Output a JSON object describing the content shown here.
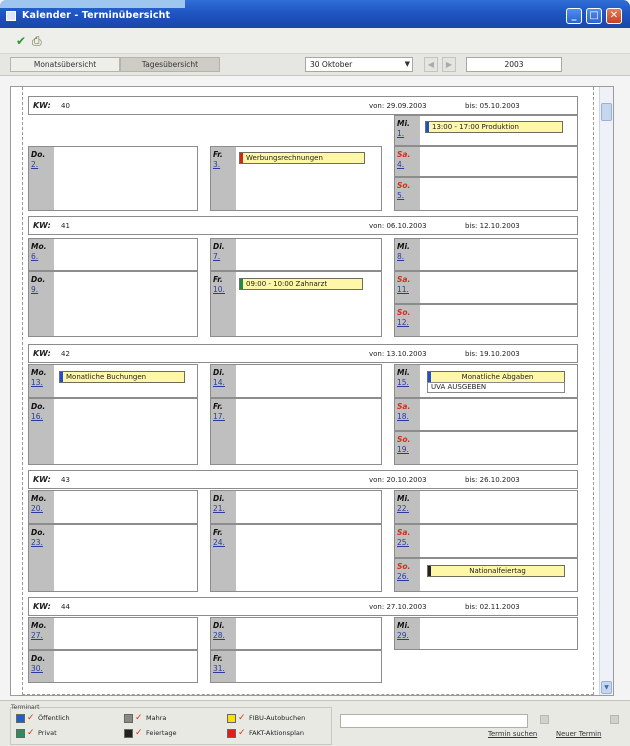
{
  "window": {
    "title": "Kalender - Terminübersicht",
    "buttons": {
      "minimize": "_",
      "maximize": "□",
      "close": "✕"
    }
  },
  "toolbar": {
    "check_icon": "✔",
    "print_icon": "⎙"
  },
  "tabs": {
    "month": "Monatsübersicht",
    "day": "Tagesübersicht",
    "date_select": "30 Oktober",
    "prev": "◀",
    "next": "▶",
    "year": "2003"
  },
  "weeks": [
    {
      "kw_label": "KW:",
      "number": "40",
      "von_label": "von:",
      "von": "29.09.2003",
      "bis_label": "bis:",
      "bis": "05.10.2003"
    },
    {
      "kw_label": "KW:",
      "number": "41",
      "von_label": "von:",
      "von": "06.10.2003",
      "bis_label": "bis:",
      "bis": "12.10.2003"
    },
    {
      "kw_label": "KW:",
      "number": "42",
      "von_label": "von:",
      "von": "13.10.2003",
      "bis_label": "bis:",
      "bis": "19.10.2003"
    },
    {
      "kw_label": "KW:",
      "number": "43",
      "von_label": "von:",
      "von": "20.10.2003",
      "bis_label": "bis:",
      "bis": "26.10.2003"
    },
    {
      "kw_label": "KW:",
      "number": "44",
      "von_label": "von:",
      "von": "27.10.2003",
      "bis_label": "bis:",
      "bis": "02.11.2003"
    }
  ],
  "days": {
    "w40_mi": {
      "name": "Mi.",
      "date": "1."
    },
    "w40_do": {
      "name": "Do.",
      "date": "2."
    },
    "w40_fr": {
      "name": "Fr.",
      "date": "3."
    },
    "w40_sa": {
      "name": "Sa.",
      "date": "4."
    },
    "w40_so": {
      "name": "So.",
      "date": "5."
    },
    "w41_mo": {
      "name": "Mo.",
      "date": "6."
    },
    "w41_di": {
      "name": "Di.",
      "date": "7."
    },
    "w41_mi": {
      "name": "Mi.",
      "date": "8."
    },
    "w41_do": {
      "name": "Do.",
      "date": "9."
    },
    "w41_fr": {
      "name": "Fr.",
      "date": "10."
    },
    "w41_sa": {
      "name": "Sa.",
      "date": "11."
    },
    "w41_so": {
      "name": "So.",
      "date": "12."
    },
    "w42_mo": {
      "name": "Mo.",
      "date": "13."
    },
    "w42_di": {
      "name": "Di.",
      "date": "14."
    },
    "w42_mi": {
      "name": "Mi.",
      "date": "15."
    },
    "w42_do": {
      "name": "Do.",
      "date": "16."
    },
    "w42_fr": {
      "name": "Fr.",
      "date": "17."
    },
    "w42_sa": {
      "name": "Sa.",
      "date": "18."
    },
    "w42_so": {
      "name": "So.",
      "date": "19."
    },
    "w43_mo": {
      "name": "Mo.",
      "date": "20."
    },
    "w43_di": {
      "name": "Di.",
      "date": "21."
    },
    "w43_mi": {
      "name": "Mi.",
      "date": "22."
    },
    "w43_do": {
      "name": "Do.",
      "date": "23."
    },
    "w43_fr": {
      "name": "Fr.",
      "date": "24."
    },
    "w43_sa": {
      "name": "Sa.",
      "date": "25."
    },
    "w43_so": {
      "name": "So.",
      "date": "26."
    },
    "w44_mo": {
      "name": "Mo.",
      "date": "27."
    },
    "w44_di": {
      "name": "Di.",
      "date": "28."
    },
    "w44_mi": {
      "name": "Mi.",
      "date": "29."
    },
    "w44_do": {
      "name": "Do.",
      "date": "30."
    },
    "w44_fr": {
      "name": "Fr.",
      "date": "31."
    }
  },
  "events": {
    "produktion": {
      "text": "13:00 - 17:00 Produktion",
      "color": "#1f4fd0"
    },
    "werbung": {
      "text": "Werbungsrechnungen",
      "color": "#d02818"
    },
    "zahnarzt": {
      "text": "09:00 - 10:00   Zahnarzt",
      "color": "#1f8a4c"
    },
    "buchungen": {
      "text": "Monatliche Buchungen",
      "color": "#1f4fd0"
    },
    "abgaben": {
      "text": "Monatliche Abgaben",
      "sub": "UVA AUSGEBEN",
      "color": "#1f4fd0"
    },
    "nationalfeiertag": {
      "text": "Nationalfeiertag",
      "color": "#222222"
    }
  },
  "footer": {
    "group_label": "Terminart",
    "legend": [
      {
        "label": "Öffentlich",
        "color": "#1f5fd0",
        "checked": "✓"
      },
      {
        "label": "Privat",
        "color": "#2f8a5c",
        "checked": "✓"
      },
      {
        "label": "Mahra",
        "color": "#8a8a84",
        "checked": "✓"
      },
      {
        "label": "Feiertage",
        "color": "#222222",
        "checked": "✓"
      },
      {
        "label": "FIBU-Autobuchen",
        "color": "#f4e400",
        "checked": "✓"
      },
      {
        "label": "FAKT-Aktionsplan",
        "color": "#e02014",
        "checked": "✓"
      }
    ],
    "search_link": "Termin suchen",
    "new_link": "Neuer Termin"
  }
}
